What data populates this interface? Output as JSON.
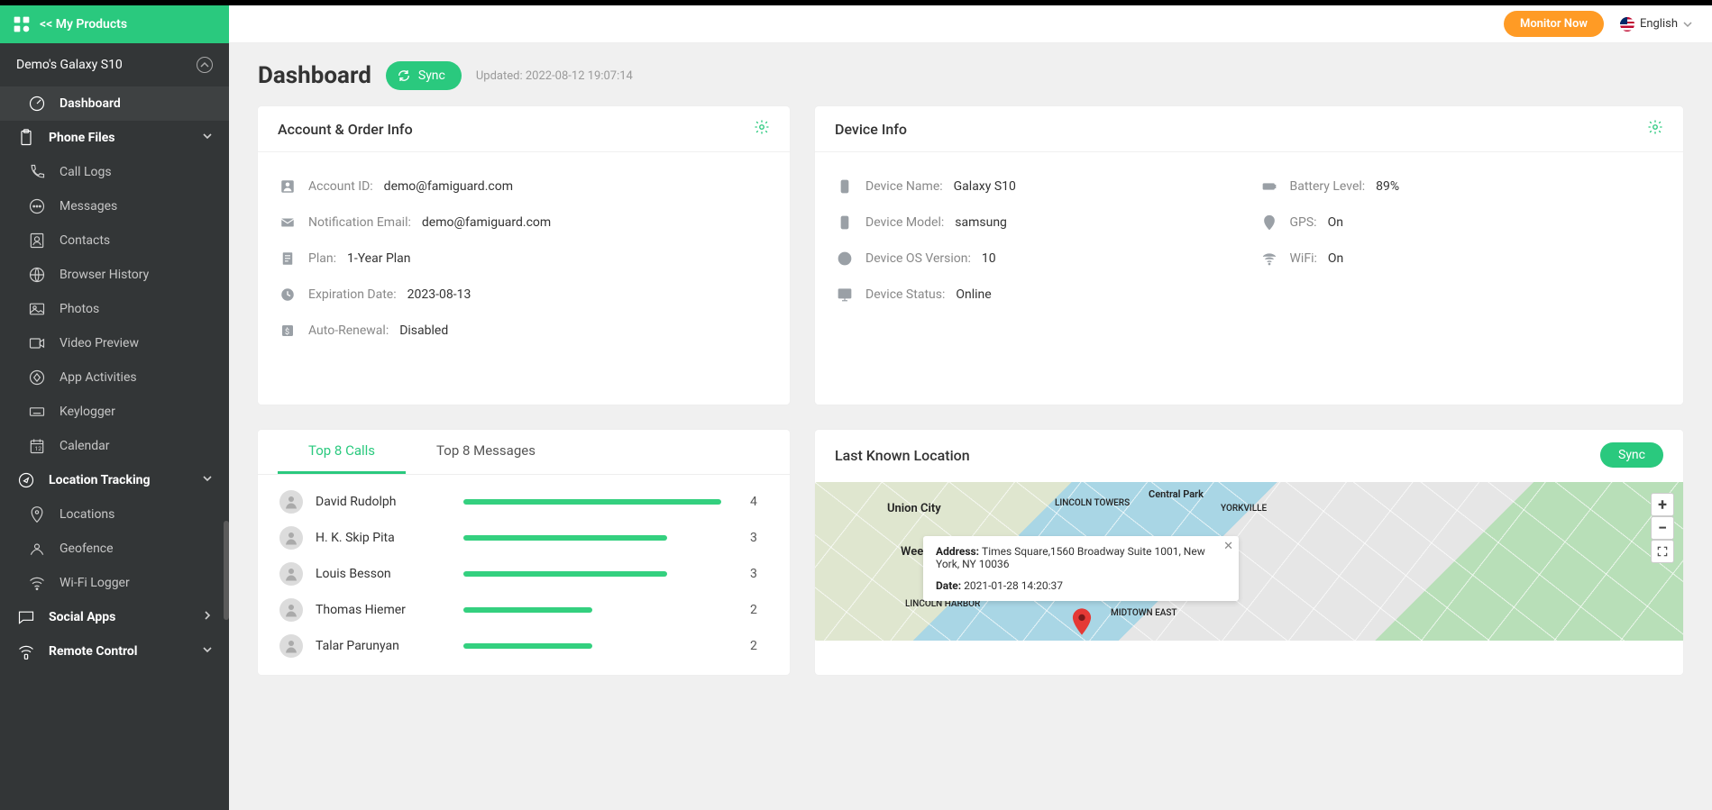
{
  "brand": {
    "back_label": "<< My Products"
  },
  "topbar": {
    "monitor_label": "Monitor Now",
    "language": "English"
  },
  "device_selector": "Demo's Galaxy S10",
  "sidebar": [
    {
      "label": "Dashboard",
      "active": true,
      "icon": "dashboard"
    },
    {
      "label": "Phone Files",
      "section": true,
      "expand": true,
      "icon": "clipboard"
    },
    {
      "label": "Call Logs",
      "icon": "phone"
    },
    {
      "label": "Messages",
      "icon": "chat"
    },
    {
      "label": "Contacts",
      "icon": "contacts"
    },
    {
      "label": "Browser History",
      "icon": "globe"
    },
    {
      "label": "Photos",
      "icon": "image"
    },
    {
      "label": "Video Preview",
      "icon": "video"
    },
    {
      "label": "App Activities",
      "icon": "app"
    },
    {
      "label": "Keylogger",
      "icon": "keyboard"
    },
    {
      "label": "Calendar",
      "icon": "calendar"
    },
    {
      "label": "Location Tracking",
      "section": true,
      "expand": true,
      "icon": "compass"
    },
    {
      "label": "Locations",
      "icon": "pin"
    },
    {
      "label": "Geofence",
      "icon": "geofence"
    },
    {
      "label": "Wi-Fi Logger",
      "icon": "wifi"
    },
    {
      "label": "Social Apps",
      "section": true,
      "expand": "right",
      "icon": "chat2"
    },
    {
      "label": "Remote Control",
      "section": true,
      "expand": true,
      "icon": "remote"
    }
  ],
  "page": {
    "title": "Dashboard",
    "sync_label": "Sync",
    "updated_prefix": "Updated: ",
    "updated_value": "2022-08-12 19:07:14"
  },
  "account": {
    "title": "Account & Order Info",
    "rows": [
      {
        "label": "Account ID: ",
        "value": "demo@famiguard.com",
        "icon": "id"
      },
      {
        "label": "Notification Email: ",
        "value": "demo@famiguard.com",
        "icon": "mail"
      },
      {
        "label": "Plan: ",
        "value": "1-Year Plan",
        "icon": "doc"
      },
      {
        "label": "Expiration Date: ",
        "value": "2023-08-13",
        "icon": "clock"
      },
      {
        "label": "Auto-Renewal: ",
        "value": "Disabled",
        "icon": "money"
      }
    ]
  },
  "device": {
    "title": "Device Info",
    "left": [
      {
        "label": "Device Name:",
        "value": "Galaxy S10",
        "icon": "phone-device"
      },
      {
        "label": "Device Model: ",
        "value": "samsung",
        "icon": "phone-device"
      },
      {
        "label": "Device OS Version: ",
        "value": "10",
        "icon": "info"
      },
      {
        "label": "Device Status:",
        "value": "Online",
        "icon": "monitor"
      }
    ],
    "right": [
      {
        "label": "Battery Level: ",
        "value": "89%",
        "icon": "battery"
      },
      {
        "label": "GPS:",
        "value": "On",
        "icon": "gps"
      },
      {
        "label": "WiFi:",
        "value": "On",
        "icon": "wifi"
      }
    ]
  },
  "calls": {
    "tab1": "Top 8 Calls",
    "tab2": "Top 8 Messages",
    "rows": [
      {
        "name": "David Rudolph",
        "count": 4,
        "pct": 100
      },
      {
        "name": "H. K. Skip Pita",
        "count": 3,
        "pct": 79
      },
      {
        "name": "Louis Besson",
        "count": 3,
        "pct": 79
      },
      {
        "name": "Thomas Hiemer",
        "count": 2,
        "pct": 50
      },
      {
        "name": "Talar Parunyan",
        "count": 2,
        "pct": 50
      }
    ]
  },
  "location": {
    "title": "Last Known Location",
    "sync": "Sync",
    "address_label": "Address: ",
    "address": "Times Square,1560 Broadway Suite 1001, New York, NY 10036",
    "date_label": "Date: ",
    "date": "2021-01-28 14:20:37",
    "labels": {
      "unioncity": "Union City",
      "weeh": "Weeh",
      "lincoln": "LINCOLN HARBOR",
      "lincolnt": "LINCOLN TOWERS",
      "central": "Central Park",
      "midtown": "MIDTOWN EAST",
      "yorkville": "YORKVILLE"
    }
  }
}
